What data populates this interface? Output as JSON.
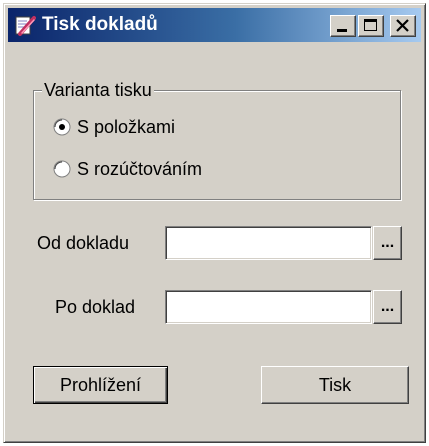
{
  "window": {
    "title": "Tisk dokladů",
    "icon": "printer-doc-icon",
    "controls": {
      "minimize": "minimize-icon",
      "maximize": "maximize-icon",
      "close": "close-icon"
    }
  },
  "print_variant": {
    "legend": "Varianta tisku",
    "options": [
      {
        "label": "S položkami",
        "selected": true
      },
      {
        "label": "S rozúčtováním",
        "selected": false
      }
    ]
  },
  "from_document": {
    "label": "Od dokladu",
    "value": "",
    "browse_label": "..."
  },
  "to_document": {
    "label": "Po doklad",
    "value": "",
    "browse_label": "..."
  },
  "buttons": {
    "preview": "Prohlížení",
    "print": "Tisk"
  },
  "colors": {
    "title_start": "#0a246a",
    "title_end": "#a6caf0",
    "face": "#d4d0c8"
  }
}
